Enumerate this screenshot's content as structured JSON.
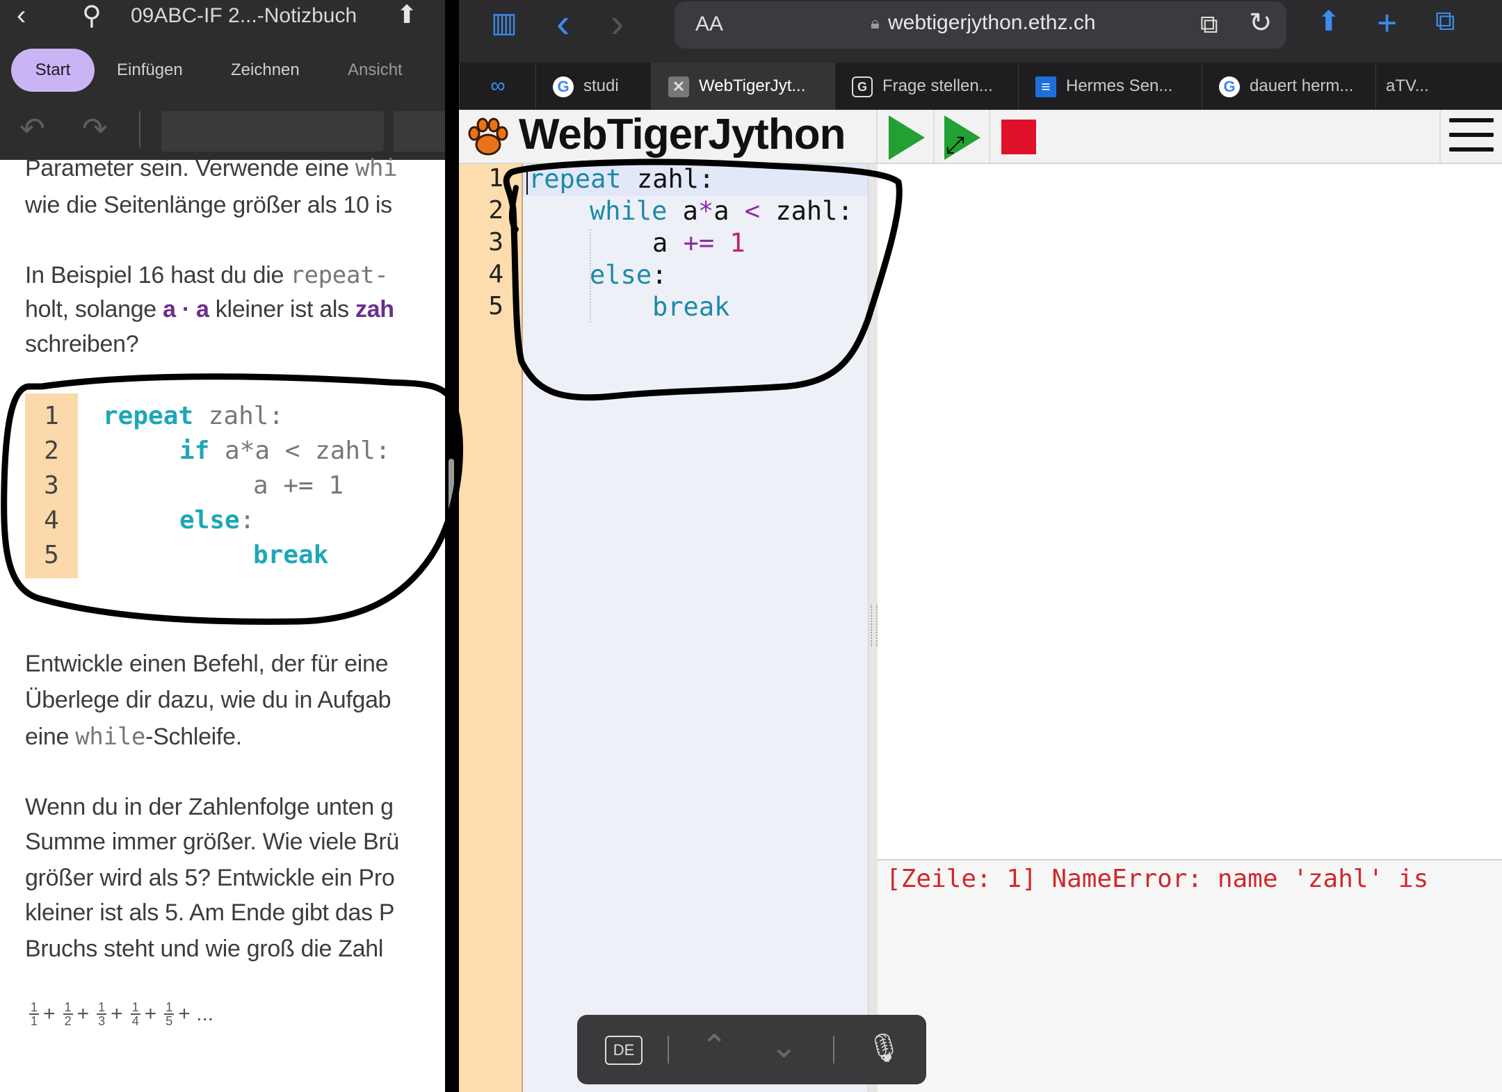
{
  "left_app": {
    "title": "09ABC-IF 2...-Notizbuch",
    "tabs": [
      "Start",
      "Einfügen",
      "Zeichnen",
      "Ansicht"
    ],
    "paragraphs": {
      "p1_line1": "Parameter sein. Verwende eine",
      "p1_line1_mono": "whi",
      "p1_line2": "wie die Seitenlänge größer als 10 is",
      "p2_line1": "In Beispiel 16 hast du die",
      "p2_line1_mono": "repeat-",
      "p2_line2_a": "holt, solange",
      "p2_line2_b": "a · a",
      "p2_line2_c": "kleiner ist als",
      "p2_line2_d": "zah",
      "p2_line3": "schreiben?",
      "p3_line1": "Entwickle einen Befehl, der für eine",
      "p3_line2": "Überlege dir dazu, wie du in Aufgab",
      "p3_line3_a": "eine",
      "p3_line3_mono": "while",
      "p3_line3_b": "-Schleife.",
      "p4_line1": "Wenn du in der Zahlenfolge unten g",
      "p4_line2": "Summe immer größer. Wie viele Brü",
      "p4_line3": "größer wird als 5? Entwickle ein Pro",
      "p4_line4": "kleiner ist als 5. Am Ende gibt das P",
      "p4_line5": "Bruchs steht und wie groß die Zahl"
    },
    "book_code": {
      "line_numbers": [
        "1",
        "2",
        "3",
        "4",
        "5"
      ],
      "l1_kw": "repeat",
      "l1_rest": " zahl:",
      "l2_kw": "if",
      "l2_rest": " a*a < zahl:",
      "l3": "a += 1",
      "l4_kw": "else",
      "l4_rest": ":",
      "l5_kw": "break"
    },
    "fractions": {
      "numerators": [
        "1",
        "1",
        "1",
        "1",
        "1"
      ],
      "denominators": [
        "1",
        "2",
        "3",
        "4",
        "5"
      ],
      "plus": "+",
      "ellipsis": "+ ..."
    }
  },
  "browser": {
    "url": "webtigerjython.ethz.ch",
    "aa_label": "AA",
    "tabs": [
      {
        "label": "studi",
        "icon": "google-icon"
      },
      {
        "label": "WebTigerJyt...",
        "icon": "close-icon",
        "active": true
      },
      {
        "label": "Frage stellen...",
        "icon": "g-box-icon"
      },
      {
        "label": "Hermes Sen...",
        "icon": "hermes-icon"
      },
      {
        "label": "dauert herm...",
        "icon": "google-icon"
      },
      {
        "label": "aTV...",
        "icon": ""
      }
    ]
  },
  "wtj": {
    "title": "WebTigerJython",
    "line_numbers": [
      "1",
      "2",
      "3",
      "4",
      "5"
    ],
    "code": {
      "l1_kw": "repeat",
      "l1_rest": " zahl:",
      "l2_kw": "while",
      "l2_a": " a",
      "l2_op1": "*",
      "l2_b": "a ",
      "l2_op2": "<",
      "l2_c": " zahl:",
      "l3_a": "a ",
      "l3_op": "+=",
      "l3_num": " 1",
      "l4_kw": "else",
      "l4_rest": ":",
      "l5_kw": "break"
    },
    "console": "[Zeile: 1] NameError: name 'zahl' is"
  },
  "keyboard_bar": {
    "language": "DE"
  }
}
